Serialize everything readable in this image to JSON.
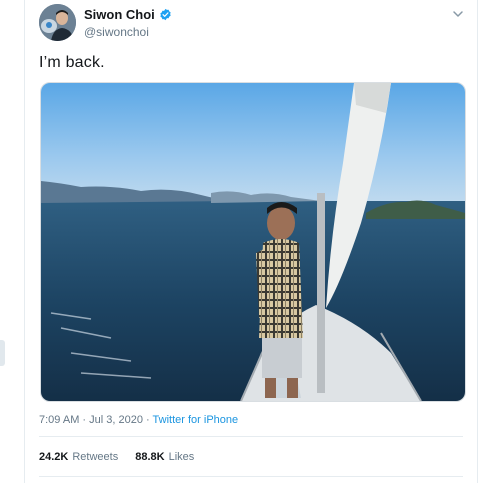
{
  "tweet": {
    "author": {
      "display_name": "Siwon Choi",
      "handle": "@siwonchoi",
      "verified": true
    },
    "text": "I’m back.",
    "timestamp": "7:09 AM · Jul 3, 2020",
    "source_separator": " · ",
    "source": "Twitter for iPhone",
    "stats": {
      "retweets_count": "24.2K",
      "retweets_label": "Retweets",
      "likes_count": "88.8K",
      "likes_label": "Likes"
    },
    "icons": {
      "verified": "verified-badge-icon",
      "menu": "chevron-down-icon"
    }
  },
  "colors": {
    "link": "#1b95e0",
    "verified": "#1da1f2",
    "secondary_text": "#657786",
    "divider": "#e6ecf0"
  }
}
